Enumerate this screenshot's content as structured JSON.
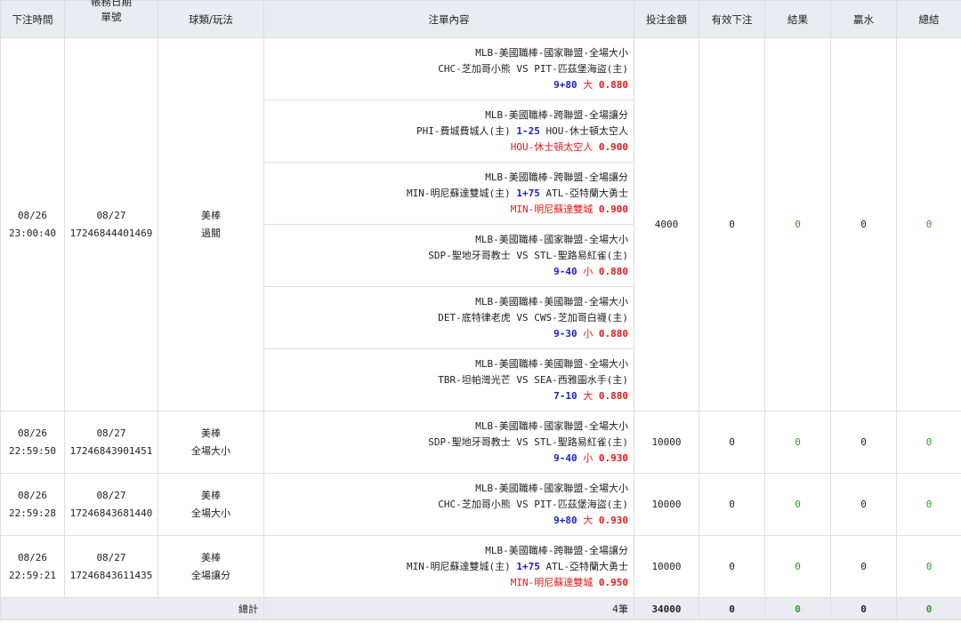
{
  "headers": {
    "bet_time": "下注時間",
    "account_date": "帳務日期",
    "order_no": "單號",
    "sport_type": "球類/玩法",
    "content": "注單內容",
    "amount": "投注金額",
    "valid_bet": "有效下注",
    "result": "結果",
    "win": "贏水",
    "total": "總結"
  },
  "orders": [
    {
      "bet_date": "08/26",
      "bet_time": "23:00:40",
      "acct_date": "08/27",
      "order_no": "17246844401469",
      "sport": "美棒",
      "play": "過關",
      "amount": "4000",
      "valid": "0",
      "result": "0",
      "win": "0",
      "total": "0",
      "legs": [
        {
          "league": "MLB-美國職棒-國家聯盟-全場大小",
          "match": {
            "pre": "CHC-芝加哥小熊 VS PIT-匹茲堡海盜(主)",
            "hl": "",
            "post": ""
          },
          "pick": {
            "line": "9+80",
            "side": "大",
            "odds": "0.880"
          }
        },
        {
          "league": "MLB-美國職棒-跨聯盟-全場讓分",
          "match": {
            "pre": "PHI-費城費城人(主) ",
            "hl": "1-25",
            "post": " HOU-休士頓太空人"
          },
          "pick": {
            "line": "",
            "side": "HOU-休士頓太空人",
            "odds": "0.900"
          }
        },
        {
          "league": "MLB-美國職棒-跨聯盟-全場讓分",
          "match": {
            "pre": "MIN-明尼蘇達雙城(主) ",
            "hl": "1+75",
            "post": " ATL-亞特蘭大勇士"
          },
          "pick": {
            "line": "",
            "side": "MIN-明尼蘇達雙城",
            "odds": "0.900"
          }
        },
        {
          "league": "MLB-美國職棒-國家聯盟-全場大小",
          "match": {
            "pre": "SDP-聖地牙哥教士 VS STL-聖路易紅雀(主)",
            "hl": "",
            "post": ""
          },
          "pick": {
            "line": "9-40",
            "side": "小",
            "odds": "0.880"
          }
        },
        {
          "league": "MLB-美國職棒-美國聯盟-全場大小",
          "match": {
            "pre": "DET-底特律老虎 VS CWS-芝加哥白襪(主)",
            "hl": "",
            "post": ""
          },
          "pick": {
            "line": "9-30",
            "side": "小",
            "odds": "0.880"
          }
        },
        {
          "league": "MLB-美國職棒-美國聯盟-全場大小",
          "match": {
            "pre": "TBR-坦帕灣光芒 VS SEA-西雅圖水手(主)",
            "hl": "",
            "post": ""
          },
          "pick": {
            "line": "7-10",
            "side": "大",
            "odds": "0.880"
          }
        }
      ]
    },
    {
      "bet_date": "08/26",
      "bet_time": "22:59:50",
      "acct_date": "08/27",
      "order_no": "17246843901451",
      "sport": "美棒",
      "play": "全場大小",
      "amount": "10000",
      "valid": "0",
      "result": "0",
      "win": "0",
      "total": "0",
      "legs": [
        {
          "league": "MLB-美國職棒-國家聯盟-全場大小",
          "match": {
            "pre": "SDP-聖地牙哥教士 VS STL-聖路易紅雀(主)",
            "hl": "",
            "post": ""
          },
          "pick": {
            "line": "9-40",
            "side": "小",
            "odds": "0.930"
          }
        }
      ]
    },
    {
      "bet_date": "08/26",
      "bet_time": "22:59:28",
      "acct_date": "08/27",
      "order_no": "17246843681440",
      "sport": "美棒",
      "play": "全場大小",
      "amount": "10000",
      "valid": "0",
      "result": "0",
      "win": "0",
      "total": "0",
      "legs": [
        {
          "league": "MLB-美國職棒-國家聯盟-全場大小",
          "match": {
            "pre": "CHC-芝加哥小熊 VS PIT-匹茲堡海盜(主)",
            "hl": "",
            "post": ""
          },
          "pick": {
            "line": "9+80",
            "side": "大",
            "odds": "0.930"
          }
        }
      ]
    },
    {
      "bet_date": "08/26",
      "bet_time": "22:59:21",
      "acct_date": "08/27",
      "order_no": "17246843611435",
      "sport": "美棒",
      "play": "全場讓分",
      "amount": "10000",
      "valid": "0",
      "result": "0",
      "win": "0",
      "total": "0",
      "legs": [
        {
          "league": "MLB-美國職棒-跨聯盟-全場讓分",
          "match": {
            "pre": "MIN-明尼蘇達雙城(主) ",
            "hl": "1+75",
            "post": " ATL-亞特蘭大勇士"
          },
          "pick": {
            "line": "",
            "side": "MIN-明尼蘇達雙城",
            "odds": "0.950"
          }
        }
      ]
    }
  ],
  "footer": {
    "label": "總計",
    "count": "4筆",
    "amount": "34000",
    "valid": "0",
    "result": "0",
    "win": "0",
    "total": "0"
  },
  "colors": {
    "header_bg": "#e9ecf1",
    "border": "#dcdfe4",
    "line_blue": "#1b21c4",
    "pick_red": "#e51a1a",
    "zero_green": "#2e9a2e"
  }
}
